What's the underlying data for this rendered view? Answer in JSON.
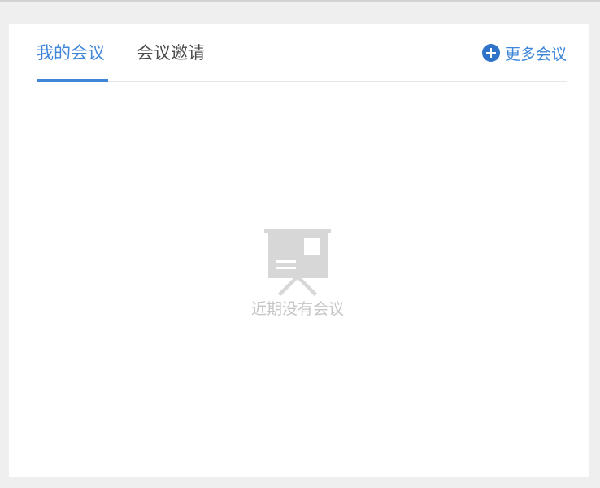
{
  "tabs": {
    "my_meetings": "我的会议",
    "invitations": "会议邀请",
    "active": "my_meetings"
  },
  "actions": {
    "more_meetings": "更多会议"
  },
  "empty_state": {
    "text": "近期没有会议",
    "icon": "presentation-board-icon"
  },
  "colors": {
    "accent": "#3f86d8",
    "tab_text": "#4a4a4a",
    "empty_text": "#c6c6c6",
    "empty_icon": "#d7d7d7",
    "page_background": "#efefef",
    "card_background": "#ffffff"
  }
}
